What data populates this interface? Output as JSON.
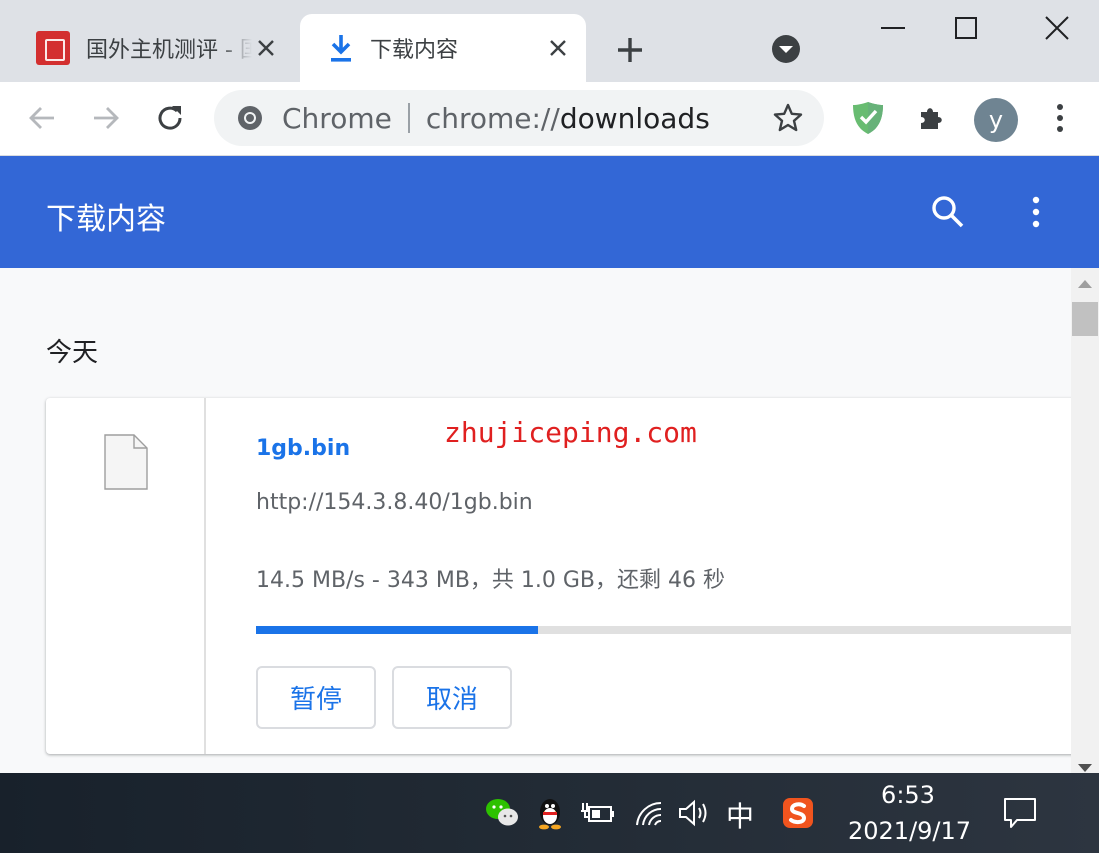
{
  "tabs": [
    {
      "title": "国外主机测评 - 国外VPS，"
    },
    {
      "title": "下载内容"
    }
  ],
  "toolbar": {
    "omnibox_site": "Chrome",
    "url_scheme": "chrome://",
    "url_host": "downloads",
    "avatar_letter": "y"
  },
  "page": {
    "title": "下载内容",
    "date_heading": "今天"
  },
  "download": {
    "file_name": "1gb.bin",
    "url": "http://154.3.8.40/1gb.bin",
    "status": "14.5 MB/s - 343 MB，共 1.0 GB，还剩 46 秒",
    "progress_fraction": 0.34,
    "pause_label": "暂停",
    "cancel_label": "取消"
  },
  "watermark": "zhujiceping.com",
  "taskbar": {
    "ime": "中",
    "time": "6:53",
    "date": "2021/9/17"
  },
  "colors": {
    "header": "#3367d6",
    "accent": "#1a73e8",
    "watermark": "#e02020"
  },
  "icons": [
    "chrome-icon",
    "star-icon",
    "shield-check-icon",
    "puzzle-icon",
    "kebab-menu-icon",
    "search-icon",
    "file-icon",
    "wechat-icon",
    "qq-icon",
    "battery-icon",
    "wifi-icon",
    "volume-icon",
    "sogou-icon",
    "notification-icon"
  ]
}
